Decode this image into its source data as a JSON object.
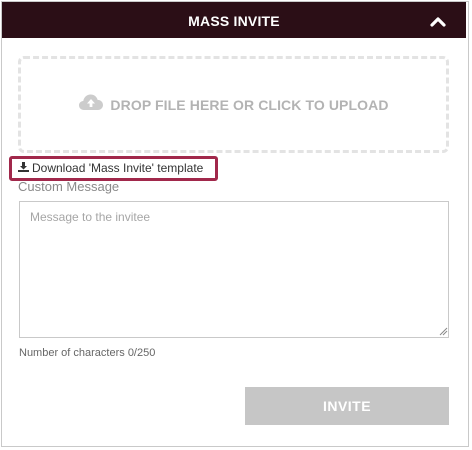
{
  "header": {
    "title": "MASS INVITE",
    "collapse_icon": "chevron-up-icon"
  },
  "dropzone": {
    "label": "DROP FILE HERE OR CLICK TO UPLOAD",
    "icon": "cloud-upload-icon"
  },
  "template_link": {
    "label": "Download 'Mass Invite' template",
    "icon": "download-icon"
  },
  "message": {
    "label": "Custom Message",
    "placeholder": "Message to the invitee",
    "char_count": "Number of characters 0/250"
  },
  "invite_button": {
    "label": "INVITE"
  },
  "colors": {
    "header_bg": "#2b0e16",
    "highlight_border": "#a1284b",
    "disabled_button": "#c6c6c6"
  }
}
